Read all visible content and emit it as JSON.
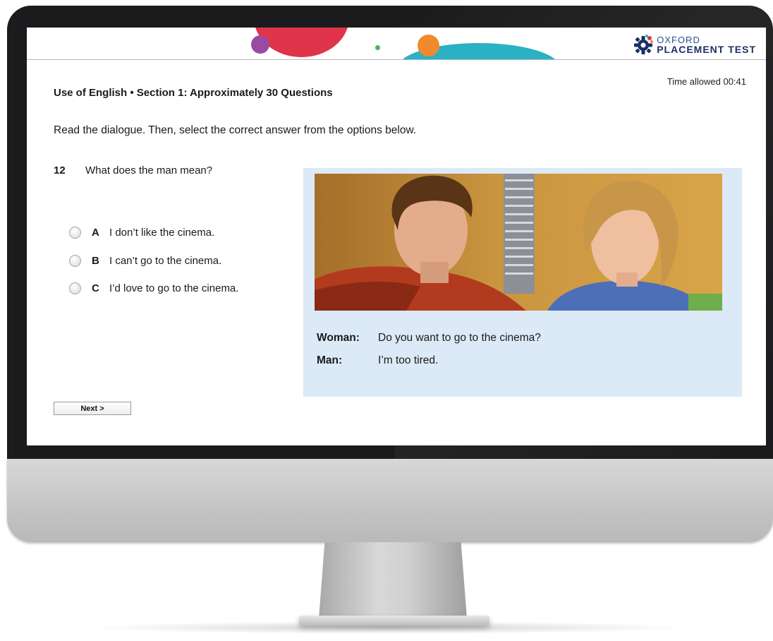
{
  "brand": {
    "line1": "OXFORD",
    "line2": "PLACEMENT TEST"
  },
  "timer": "Time allowed 00:41",
  "section_title": "Use of English • Section 1: Approximately 30 Questions",
  "instruction": "Read the dialogue. Then, select the correct answer from the options below.",
  "question": {
    "number": "12",
    "text": "What does the man mean?"
  },
  "options": [
    {
      "letter": "A",
      "text": "I don’t like the cinema."
    },
    {
      "letter": "B",
      "text": "I can’t go to the cinema."
    },
    {
      "letter": "C",
      "text": "I’d love to go to the cinema."
    }
  ],
  "dialogue": [
    {
      "speaker": "Woman:",
      "line": "Do you want to go to the cinema?"
    },
    {
      "speaker": "Man:",
      "line": "I’m too tired."
    }
  ],
  "next_label": "Next >",
  "colors": {
    "panel_bg": "#dceaf7",
    "brand_blue": "#1b2f66",
    "deco_red": "#e0344a",
    "deco_purple": "#9a4aa3",
    "deco_orange": "#f08a2c",
    "deco_teal": "#2ab1c3",
    "deco_green": "#3dbb5a"
  },
  "icons": {
    "logo": "oxford-gear-icon",
    "photo": "man-and-woman-talking-photo"
  }
}
